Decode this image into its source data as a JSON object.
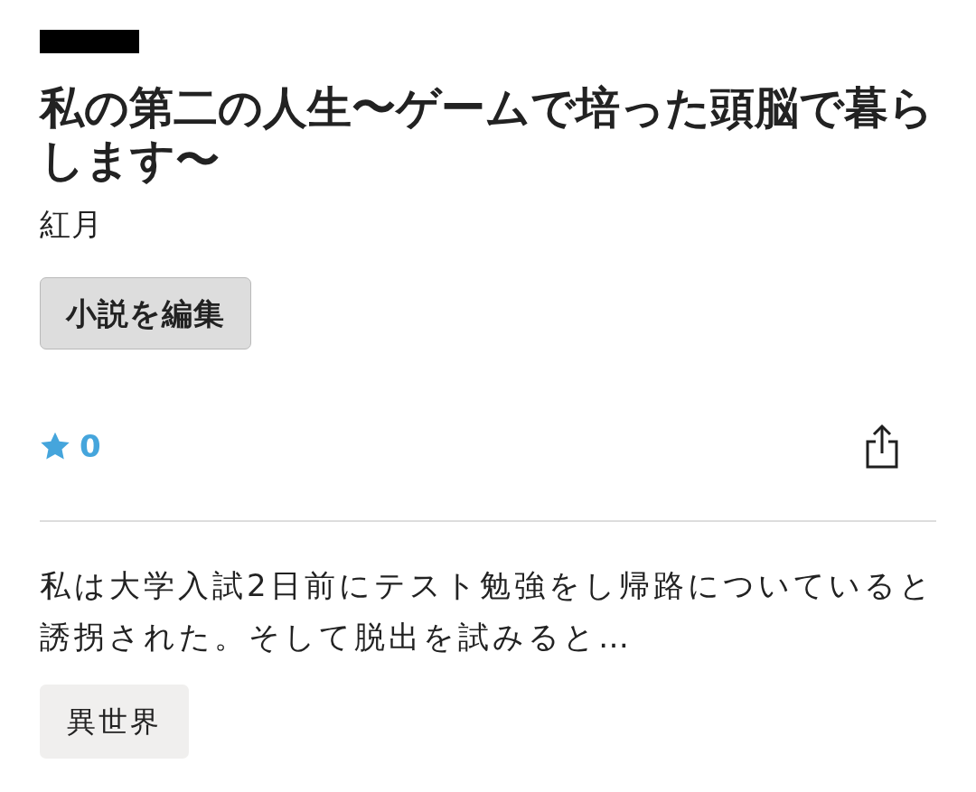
{
  "badge": {
    "redacted": true
  },
  "novel": {
    "title": "私の第二の人生〜ゲームで培った頭脳で暮らします〜",
    "author": "紅月"
  },
  "edit_button": {
    "label": "小説を編集"
  },
  "actions": {
    "favorite_count": "0"
  },
  "synopsis": "私は大学入試2日前にテスト勉強をし帰路についていると誘拐された。そして脱出を試みると…",
  "tags": [
    {
      "label": "異世界"
    }
  ]
}
